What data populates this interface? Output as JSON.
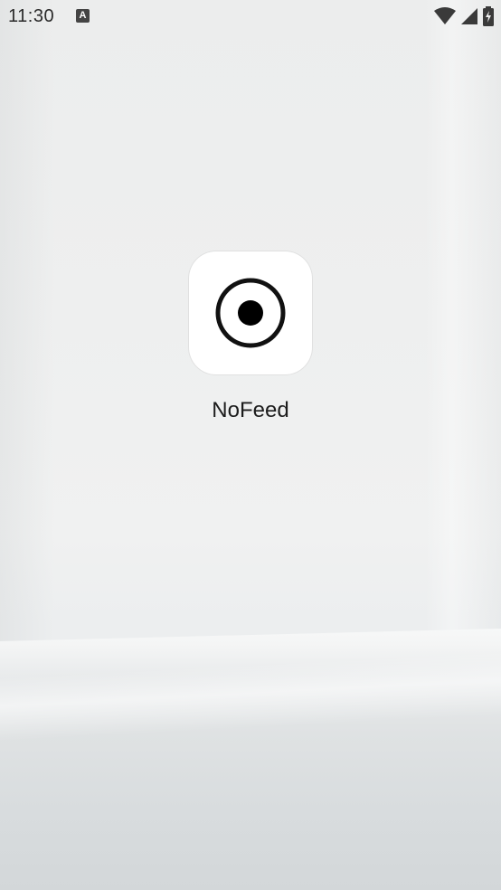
{
  "status_bar": {
    "time": "11:30",
    "notification_icon": "A",
    "icons": [
      "wifi-icon",
      "cell-signal-icon",
      "battery-charging-icon"
    ]
  },
  "home_screen": {
    "apps": [
      {
        "label": "NoFeed",
        "icon": "target-dot-icon"
      }
    ]
  }
}
